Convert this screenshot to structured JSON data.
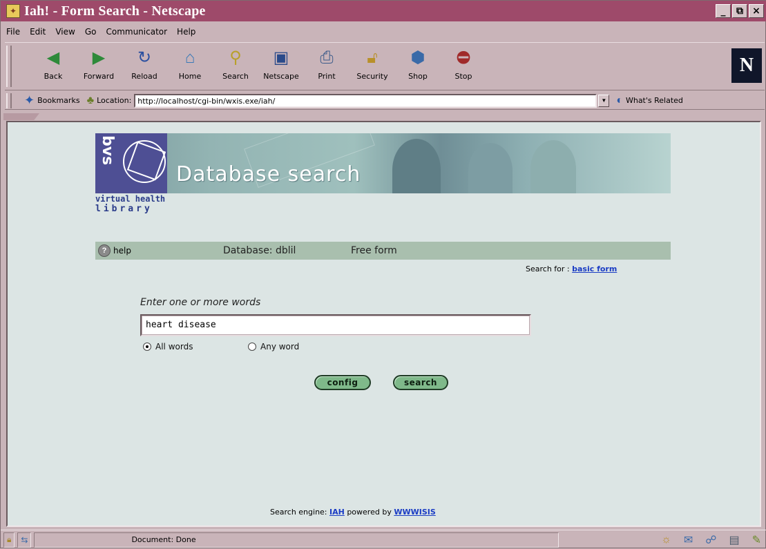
{
  "window": {
    "title": "Iah! - Form Search - Netscape",
    "controls": [
      "_",
      "⧉",
      "×"
    ]
  },
  "menu": [
    "File",
    "Edit",
    "View",
    "Go",
    "Communicator",
    "Help"
  ],
  "toolbar": {
    "buttons": [
      {
        "label": "Back",
        "icon": "back-arrow-icon"
      },
      {
        "label": "Forward",
        "icon": "forward-arrow-icon"
      },
      {
        "label": "Reload",
        "icon": "reload-icon"
      },
      {
        "label": "Home",
        "icon": "home-icon"
      },
      {
        "label": "Search",
        "icon": "search-icon"
      },
      {
        "label": "Netscape",
        "icon": "netscape-icon"
      },
      {
        "label": "Print",
        "icon": "print-icon"
      },
      {
        "label": "Security",
        "icon": "lock-icon"
      },
      {
        "label": "Shop",
        "icon": "shop-icon"
      },
      {
        "label": "Stop",
        "icon": "stop-icon"
      }
    ],
    "brand": "N"
  },
  "location": {
    "bookmarks_label": "Bookmarks",
    "location_label": "Location:",
    "url": "http://localhost/cgi-bin/wxis.exe/iah/",
    "related_label": "What's Related"
  },
  "page": {
    "banner_title": "Database search",
    "logo_text": "bvs",
    "vhl_line1": "virtual health",
    "vhl_line2": "library",
    "help_label": "help",
    "database_label": "Database: dblil",
    "form_type": "Free form",
    "search_for_label": "Search for :",
    "search_for_link": "basic form",
    "prompt": "Enter one or more words",
    "query_value": "heart disease",
    "radio_all": "All words",
    "radio_any": "Any word",
    "radio_selected": "all",
    "config_button": "config",
    "search_button": "search",
    "footer_prefix": "Search engine:",
    "footer_iah": "IAH",
    "footer_mid": "powered by",
    "footer_wwwisis": "WWWISIS"
  },
  "status": {
    "text": "Document: Done"
  }
}
